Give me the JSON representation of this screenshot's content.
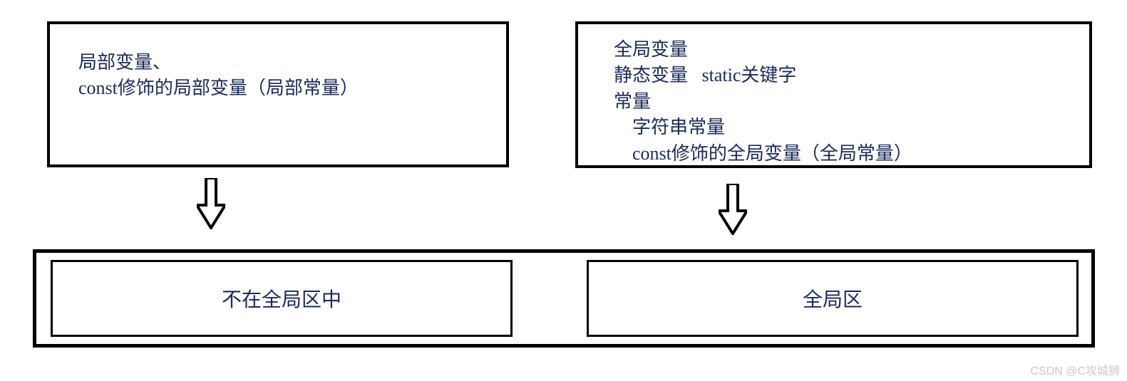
{
  "left_box": {
    "line1": "局部变量、",
    "line2": "const修饰的局部变量（局部常量）"
  },
  "right_box": {
    "line1": "全局变量",
    "line2": "静态变量   static关键字",
    "line3": "常量",
    "line4": "    字符串常量",
    "line5": "    const修饰的全局变量（全局常量）"
  },
  "bottom": {
    "left_label": "不在全局区中",
    "right_label": "全局区"
  },
  "watermark": "CSDN @C攻城狮"
}
